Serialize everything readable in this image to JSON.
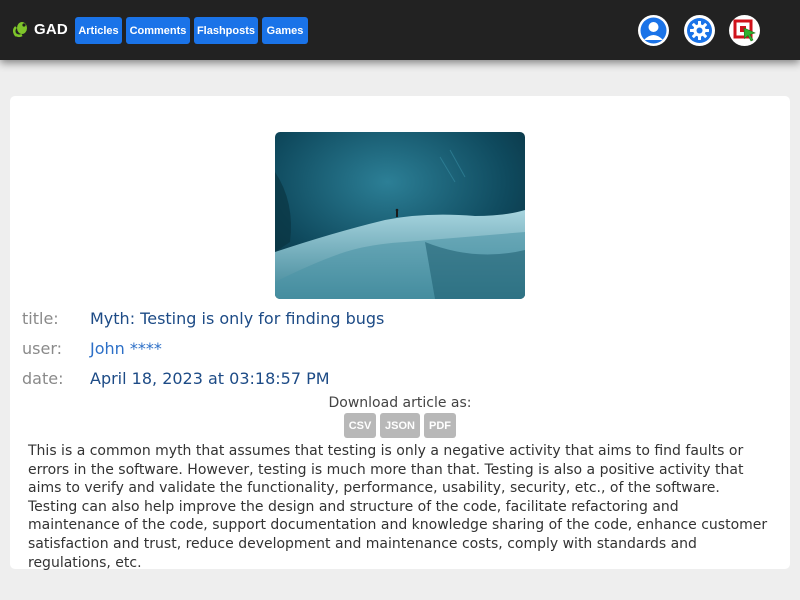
{
  "header": {
    "brand": "GAD",
    "nav": [
      {
        "label": "Articles"
      },
      {
        "label": "Comments"
      },
      {
        "label": "Flashposts"
      },
      {
        "label": "Games"
      }
    ]
  },
  "article": {
    "meta": [
      {
        "label": "title:",
        "value": "Myth: Testing is only for finding bugs"
      },
      {
        "label": "user:",
        "value": "John ****"
      },
      {
        "label": "date:",
        "value": "April 18, 2023 at 03:18:57 PM"
      }
    ],
    "download_label": "Download article as:",
    "download_formats": [
      "CSV",
      "JSON",
      "PDF"
    ],
    "body": "This is a common myth that assumes that testing is only a negative activity that aims to find faults or errors in the software. However, testing is much more than that. Testing is also a positive activity that aims to verify and validate the functionality, performance, usability, security, etc., of the software. Testing can also help improve the design and structure of the code, facilitate refactoring and maintenance of the code, support documentation and knowledge sharing of the code, enhance customer satisfaction and trust, reduce development and maintenance costs, comply with standards and regulations, etc."
  },
  "colors": {
    "topbar": "#222222",
    "nav_button": "#1a73e8",
    "meta_value": "#1d4b86",
    "download_button": "#b8b8b8"
  },
  "icons": [
    "gecko-logo-icon",
    "user-icon",
    "gear-icon",
    "logout-icon"
  ]
}
